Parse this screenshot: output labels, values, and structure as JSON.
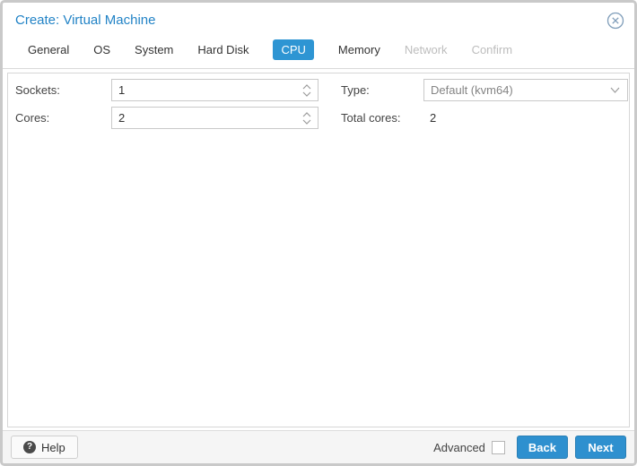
{
  "window": {
    "title": "Create: Virtual Machine",
    "close_icon": "circle-x-icon"
  },
  "tabs": [
    {
      "label": "General",
      "state": "normal"
    },
    {
      "label": "OS",
      "state": "normal"
    },
    {
      "label": "System",
      "state": "normal"
    },
    {
      "label": "Hard Disk",
      "state": "normal"
    },
    {
      "label": "CPU",
      "state": "active"
    },
    {
      "label": "Memory",
      "state": "normal"
    },
    {
      "label": "Network",
      "state": "disabled"
    },
    {
      "label": "Confirm",
      "state": "disabled"
    }
  ],
  "form": {
    "sockets": {
      "label": "Sockets:",
      "value": "1",
      "control": "spinner"
    },
    "cores": {
      "label": "Cores:",
      "value": "2",
      "control": "spinner"
    },
    "type": {
      "label": "Type:",
      "value": "Default (kvm64)",
      "control": "dropdown"
    },
    "total": {
      "label": "Total cores:",
      "value": "2",
      "control": "static"
    }
  },
  "footer": {
    "help_label": "Help",
    "help_icon_glyph": "?",
    "advanced_label": "Advanced",
    "advanced_checked": false,
    "back_label": "Back",
    "next_label": "Next"
  },
  "colors": {
    "title_blue": "#2283c6",
    "active_tab_blue": "#2e95d3",
    "button_blue": "#2e90cf",
    "disabled_tab_gray": "#bdbdbd",
    "footer_bg": "#f5f5f5",
    "dialog_border": "#c9c9c9"
  }
}
